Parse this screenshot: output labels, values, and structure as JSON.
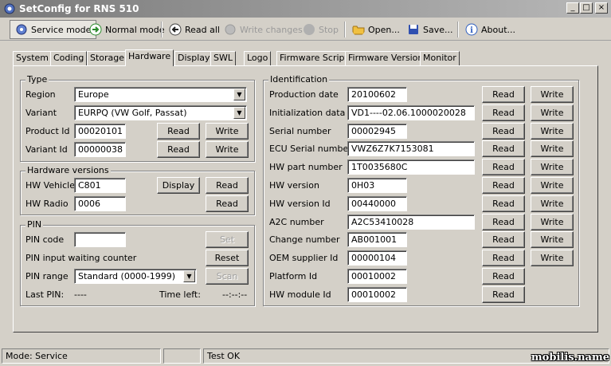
{
  "window": {
    "title": "SetConfig for RNS 510"
  },
  "toolbar": {
    "service_mode": "Service mode",
    "normal_mode": "Normal mode",
    "read_all": "Read all",
    "write_changes": "Write changes",
    "stop": "Stop",
    "open": "Open...",
    "save": "Save...",
    "about": "About..."
  },
  "tabs": [
    "System",
    "Coding",
    "Storage",
    "Hardware",
    "Display",
    "SWL",
    "Logo",
    "Firmware Script",
    "Firmware Version",
    "Monitor"
  ],
  "type_group": {
    "title": "Type",
    "region_label": "Region",
    "region_value": "Europe",
    "variant_label": "Variant",
    "variant_value": "EURPQ (VW Golf, Passat)",
    "product_id_label": "Product Id",
    "product_id_value": "00020101",
    "variant_id_label": "Variant Id",
    "variant_id_value": "00000038"
  },
  "hw_group": {
    "title": "Hardware versions",
    "vehicle_label": "HW Vehicle",
    "vehicle_value": "C801",
    "radio_label": "HW Radio",
    "radio_value": "0006",
    "display_btn": "Display"
  },
  "pin_group": {
    "title": "PIN",
    "code_label": "PIN code",
    "code_value": "",
    "waiting_label": "PIN input waiting counter",
    "range_label": "PIN range",
    "range_value": "Standard (0000-1999)",
    "last_pin_label": "Last PIN:",
    "last_pin_value": "----",
    "time_left_label": "Time left:",
    "time_left_value": "--:--:--",
    "set_btn": "Set",
    "reset_btn": "Reset",
    "scan_btn": "Scan"
  },
  "buttons": {
    "read": "Read",
    "write": "Write"
  },
  "identification": {
    "title": "Identification",
    "rows": [
      {
        "label": "Production date",
        "value": "20100602",
        "write": true
      },
      {
        "label": "Initialization data",
        "value": "VD1----02.06.1000020028",
        "write": true
      },
      {
        "label": "Serial number",
        "value": "00002945",
        "write": true
      },
      {
        "label": "ECU Serial number",
        "value": "VWZ6Z7K7153081",
        "write": true
      },
      {
        "label": "HW part number",
        "value": "1T0035680C",
        "write": true
      },
      {
        "label": "HW version",
        "value": "0H03",
        "write": true
      },
      {
        "label": "HW version Id",
        "value": "00440000",
        "write": true
      },
      {
        "label": "A2C number",
        "value": "A2C53410028",
        "write": true
      },
      {
        "label": "Change number",
        "value": "AB001001",
        "write": true
      },
      {
        "label": "OEM supplier Id",
        "value": "00000104",
        "write": true
      },
      {
        "label": "Platform Id",
        "value": "00010002",
        "write": false
      },
      {
        "label": "HW module Id",
        "value": "00010002",
        "write": false
      }
    ]
  },
  "status": {
    "mode": "Mode: Service",
    "middle": "",
    "result": "Test OK"
  },
  "watermark": "mobilis.name",
  "colors": {
    "background": "#d4d0c8",
    "titlebar_start": "#7a7a7a",
    "titlebar_end": "#b8b8b8"
  }
}
